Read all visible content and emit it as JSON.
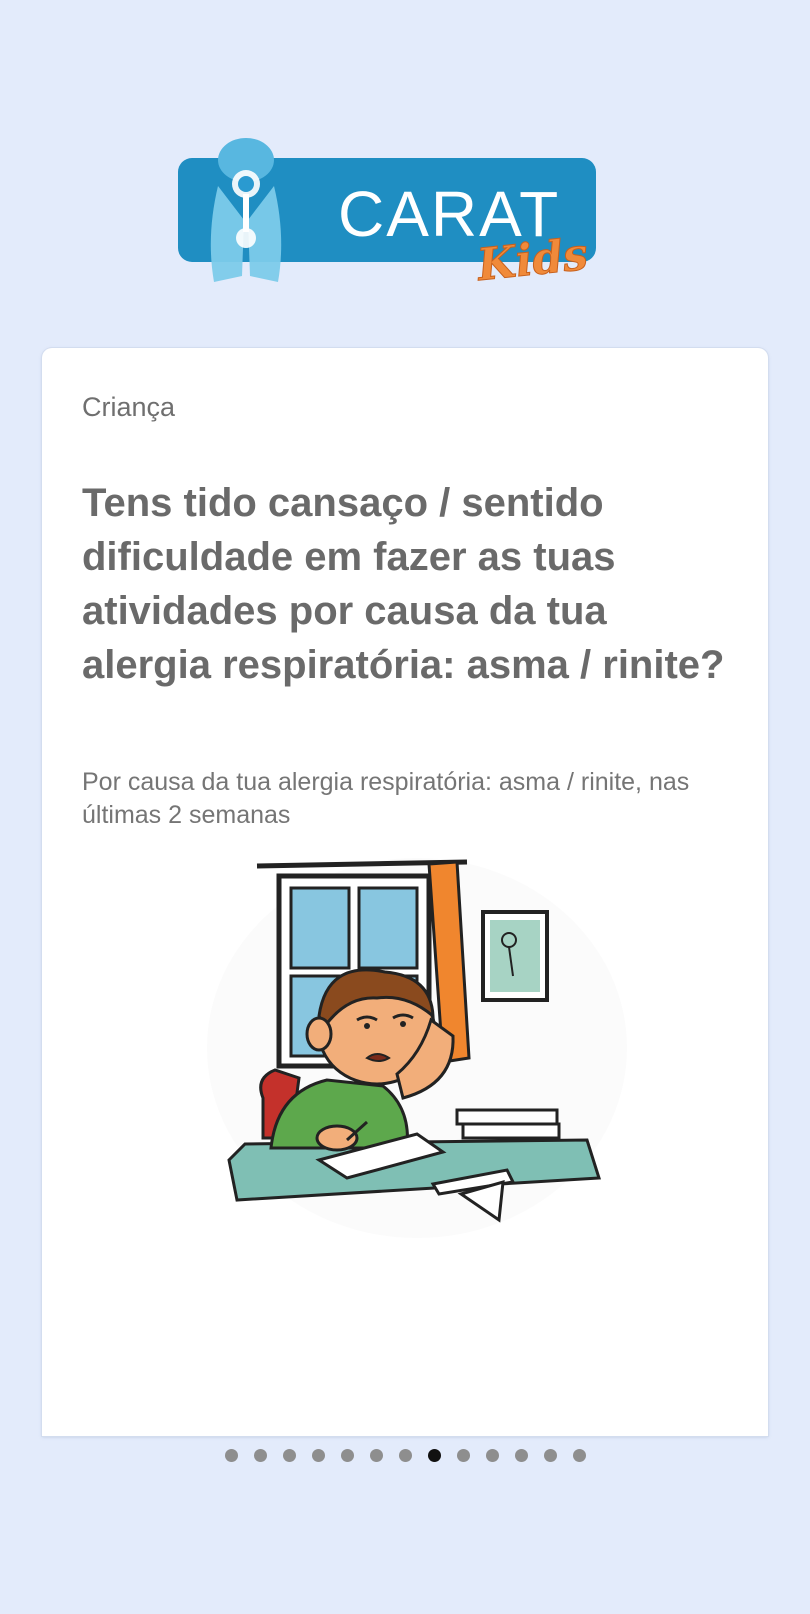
{
  "app": {
    "logo_text": "CARAT",
    "logo_subtext": "Kids"
  },
  "card": {
    "category": "Criança",
    "question": "Tens tido cansaço / sentido dificuldade em fazer as tuas atividades por causa da tua alergia respiratória: asma / rinite?",
    "subtitle": "Por causa da tua alergia respiratória: asma / rinite, nas últimas 2 semanas"
  },
  "pager": {
    "total": 13,
    "current": 8
  },
  "colors": {
    "background": "#e3ebfb",
    "logo_blue": "#1f8ec2",
    "kids_orange": "#f08a3a",
    "text_gray": "#6a6a6a",
    "dot_inactive": "#8e8e8e",
    "dot_active": "#111111"
  }
}
